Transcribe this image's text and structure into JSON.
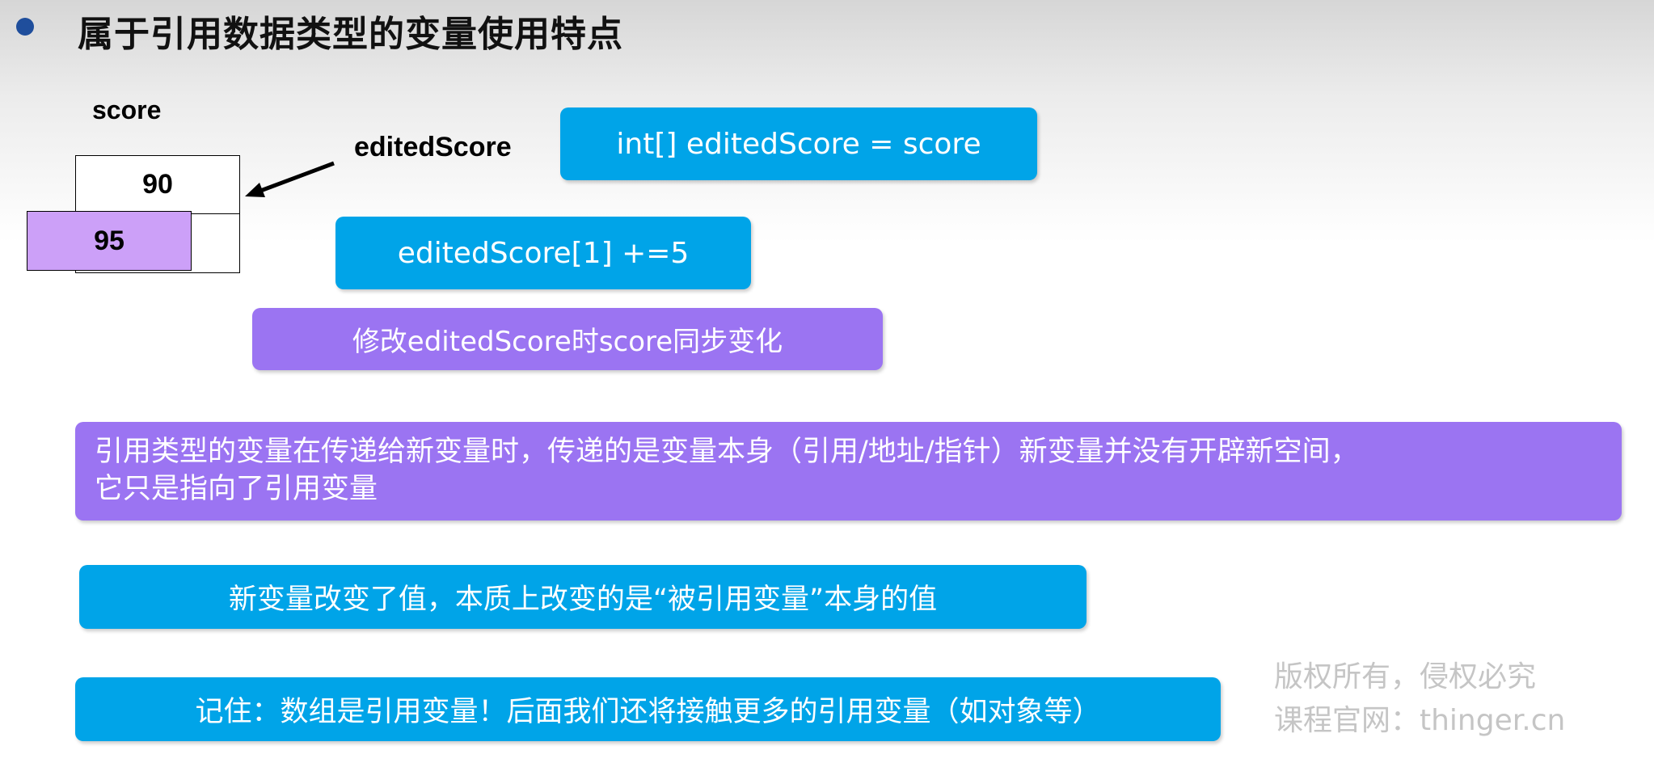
{
  "slide": {
    "title": "属于引用数据类型的变量使用特点",
    "memory": {
      "score_label": "score",
      "edited_label": "editedScore",
      "cell_top_value": "90",
      "cell_bottom_value": "95"
    },
    "code_assign": "int[]  editedScore  = score",
    "code_modify": "editedScore[1]  +=5",
    "note_sync": "修改editedScore时score同步变化",
    "explanation_line1": "引用类型的变量在传递给新变量时，传递的是变量本身（引用/地址/指针）新变量并没有开辟新空间，",
    "explanation_line2": "它只是指向了引用变量",
    "point_value_change": "新变量改变了值，本质上改变的是“被引用变量”本身的值",
    "point_remember": "记住：数组是引用变量！后面我们还将接触更多的引用变量（如对象等）",
    "watermark_line1": "版权所有，侵权必究",
    "watermark_line2": "课程官网：thinger.cn"
  },
  "colors": {
    "blue_box": "#00a4e8",
    "purple_box": "#9b74f2",
    "highlight_cell": "#cca0f8",
    "bullet": "#1f4e9c"
  },
  "icons": [
    "bullet-dot",
    "pointer-arrow"
  ]
}
